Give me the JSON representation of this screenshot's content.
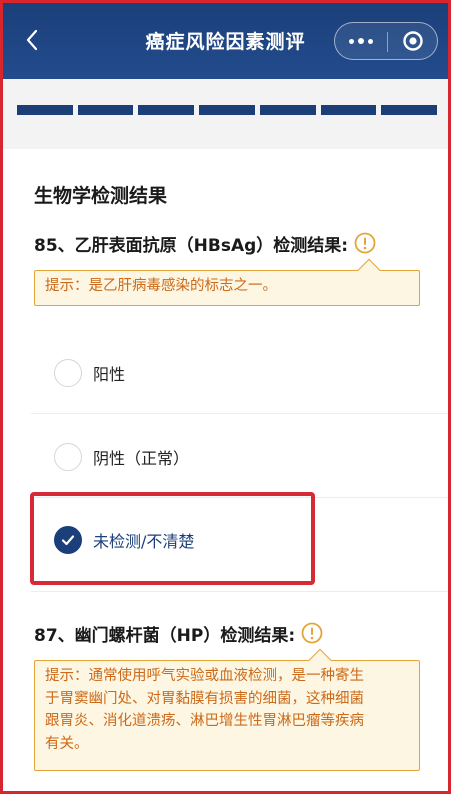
{
  "header": {
    "title": "癌症风险因素测评",
    "back_icon": "chevron-left-icon",
    "more_icon": "more-dots-icon",
    "close_icon": "target-circle-icon",
    "background": "#1b3f7a"
  },
  "progress": {
    "segments": 7,
    "color": "#1c3f78"
  },
  "section": {
    "title": "生物学检测结果"
  },
  "questions": [
    {
      "label": "85、乙肝表面抗原（HBsAg）检测结果:",
      "tip": "提示：是乙肝病毒感染的标志之一。",
      "options": [
        {
          "label": "阳性",
          "checked": false
        },
        {
          "label": "阴性（正常）",
          "checked": false
        },
        {
          "label": "未检测/不清楚",
          "checked": true
        }
      ]
    },
    {
      "label": "87、幽门螺杆菌（HP）检测结果:",
      "tip_lines": [
        "提示：通常使用呼气实验或血液检测，是一种寄生",
        "于胃窦幽门处、对胃黏膜有损害的细菌，这种细菌",
        "跟胃炎、消化道溃疡、淋巴增生性胃淋巴瘤等疾病",
        "有关。"
      ]
    }
  ],
  "colors": {
    "accent": "#1b3f7a",
    "tip_border": "#e2a53a",
    "tip_text": "#cc6a1a",
    "tip_background": "#fdf6e2",
    "highlight": "#d62a37"
  }
}
